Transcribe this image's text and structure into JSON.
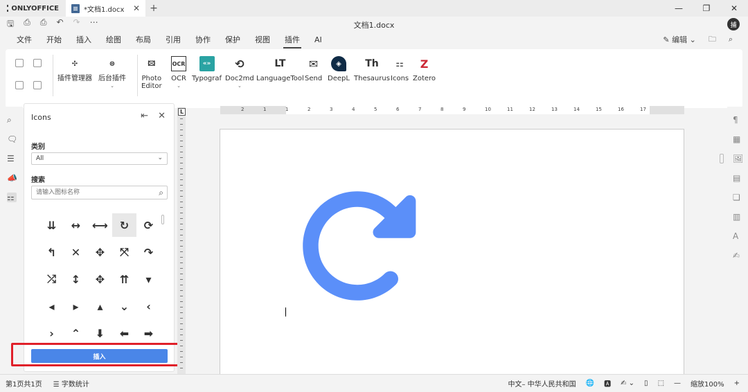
{
  "app": {
    "logo": "ONLYOFFICE",
    "tab_title": "*文档1.docx",
    "doc_title": "文档1.docx",
    "avatar": "捕"
  },
  "window": {
    "minimize": "—",
    "restore": "❐",
    "close": "✕"
  },
  "menu": {
    "items": [
      "文件",
      "开始",
      "插入",
      "绘图",
      "布局",
      "引用",
      "协作",
      "保护",
      "视图",
      "插件",
      "AI"
    ],
    "active": "插件",
    "edit_label": "编辑"
  },
  "ribbon": {
    "plugin_manager": "插件管理器",
    "background_plugins": "后台插件",
    "photo_editor_1": "Photo",
    "photo_editor_2": "Editor",
    "ocr": "OCR",
    "typograf": "Typograf",
    "doc2md": "Doc2md",
    "languagetool": "LanguageTool",
    "send": "Send",
    "deepl": "DeepL",
    "thesaurus": "Thesaurus",
    "icons": "Icons",
    "zotero": "Zotero"
  },
  "panel": {
    "title": "Icons",
    "category_label": "类别",
    "category_value": "All",
    "search_label": "搜索",
    "search_placeholder": "请输入图标名称",
    "insert_label": "插入",
    "icons": [
      [
        "⇊",
        "↔",
        "⟷",
        "↻",
        "⟳"
      ],
      [
        "↰",
        "✕",
        "✥",
        "⤧",
        "↷"
      ],
      [
        "⤮",
        "↕",
        "✥",
        "⇈",
        "▾"
      ],
      [
        "◂",
        "▸",
        "▴",
        "⌄",
        "‹"
      ],
      [
        "›",
        "⌃",
        "⬇",
        "⬅",
        "➡"
      ]
    ],
    "selected_icon": [
      0,
      3
    ]
  },
  "ruler": {
    "h_numbers": [
      "2",
      "1",
      "1",
      "2",
      "3",
      "4",
      "5",
      "6",
      "7",
      "8",
      "9",
      "10",
      "11",
      "12",
      "13",
      "14",
      "15",
      "16",
      "17"
    ]
  },
  "status": {
    "page": "第1页共1页",
    "word_count": "字数统计",
    "language": "中文– 中华人民共和国",
    "zoom": "缩放100%"
  },
  "colors": {
    "accent": "#4a86e8",
    "sync_icon": "#5b8ff9",
    "highlight": "#e0202a"
  }
}
